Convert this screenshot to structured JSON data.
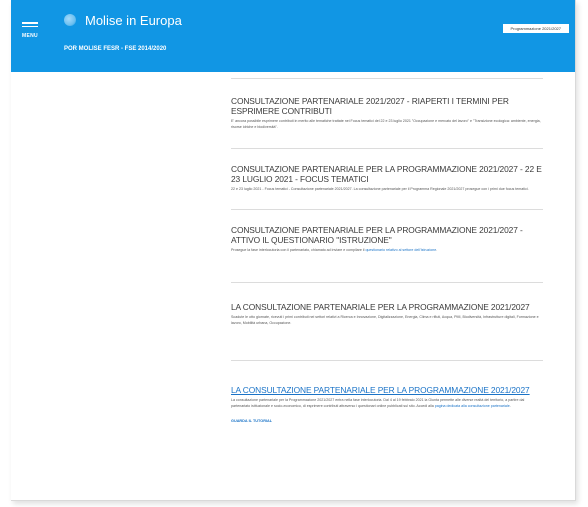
{
  "header": {
    "menu_label": "MENU",
    "site_title": "Molise in Europa",
    "site_subtitle": "POR MOLISE FESR - FSE 2014/2020",
    "top_link": "Programmazione 2021/2027"
  },
  "articles": [
    {
      "title": "Consultazione partenariale 2021/2027 - Riaperti i termini per esprimere contributi",
      "excerpt": "E' ancora possibile esprimere contributi in merito alle tematiche trattate nei Focus tematici del 22 e 23 luglio 2021 \"Occupazione e mercato del lavoro\" e \"Transizione ecologica: ambiente, energia, risorse idriche e biodiversità\"."
    },
    {
      "title": "Consultazione partenariale per la programmazione 2021/2027 - 22 e 23 luglio 2021 - Focus tematici",
      "excerpt": "22 e 23 luglio 2021 - Focus tematici - Consultazione partenariale 2021/2027. La consultazione partenariale per il Programma Regionale 2021/2027 prosegue con i primi due focus tematici."
    },
    {
      "title": "Consultazione partenariale per la programmazione 2021/2027 - Attivo il questionario \"Istruzione\"",
      "excerpt_before": "Prosegue la fase interlocutoria con il partenariato, chiamato ad inviare e compilare il ",
      "excerpt_link": "questionario relativo al settore dell'Istruzione",
      "excerpt_after": "."
    },
    {
      "title": "La consultazione partenariale per la programmazione 2021/2027",
      "excerpt": "Scadute le otto giornate, ricevuti i primi contributi nei settori relativi a Ricerca e Innovazione, Digitalizzazione, Energia, Clima e rifiuti, Acqua, PMI, Biodiversità, Infrastrutture digitali, Formazione e lavoro, Mobilità urbana, Occupazione."
    },
    {
      "title": "La consultazione partenariale per la programmazione 2021/2027",
      "excerpt_before": "La consultazione partenariale per la Programmazione 2021/2027 entra nella fase interlocutoria. Dal 4 al 19 febbraio 2021 la Giunta permette alle diverse realtà del territorio, a partire dal partenariato istituzionale e socio-economico, di esprimere contributi attraverso i questionari online pubblicati sul sito. Accedi alla ",
      "excerpt_link": "pagina dedicata alla consultazione partenariale",
      "excerpt_after": ".",
      "read_more": "GUARDA IL TUTORIAL"
    }
  ]
}
